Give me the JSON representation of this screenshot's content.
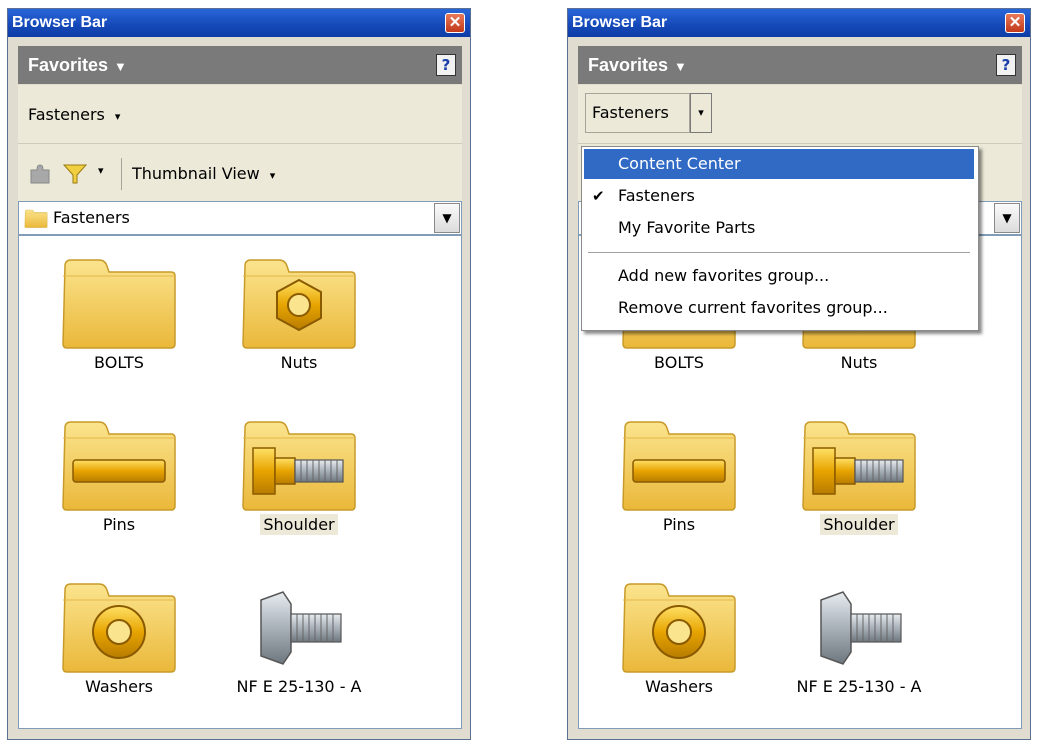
{
  "panel": {
    "title": "Browser Bar",
    "close_glyph": "✕",
    "tab_label": "Favorites",
    "tab_arrow": "▼",
    "help_glyph": "?",
    "group_label": "Fasteners",
    "dropdown_arrow": "▾",
    "view_label": "Thumbnail View",
    "path_label": "Fasteners",
    "path_arrow": "▼"
  },
  "items": [
    {
      "label": "BOLTS",
      "icon": "folder-icon"
    },
    {
      "label": "Nuts",
      "icon": "folder-nut-icon"
    },
    {
      "label": "Pins",
      "icon": "folder-pin-icon"
    },
    {
      "label": "Shoulder",
      "icon": "folder-shoulder-bolt-icon",
      "selected": true
    },
    {
      "label": "Washers",
      "icon": "folder-washer-icon"
    },
    {
      "label": "NF E 25-130 - A",
      "icon": "hex-bolt-icon"
    }
  ],
  "menu": {
    "items": [
      {
        "label": "Content Center",
        "highlighted": true,
        "checked": false
      },
      {
        "label": "Fasteners",
        "highlighted": false,
        "checked": true
      },
      {
        "label": "My Favorite Parts",
        "highlighted": false,
        "checked": false
      },
      {
        "label": "Add new favorites group...",
        "highlighted": false,
        "checked": false
      },
      {
        "label": "Remove current favorites group...",
        "highlighted": false,
        "checked": false
      }
    ],
    "check_glyph": "✔"
  },
  "colors": {
    "title_bar": "#1448b8",
    "favorites_bar": "#7a7a7a",
    "menu_highlight": "#316ac5",
    "folder": "#f5cf56"
  }
}
